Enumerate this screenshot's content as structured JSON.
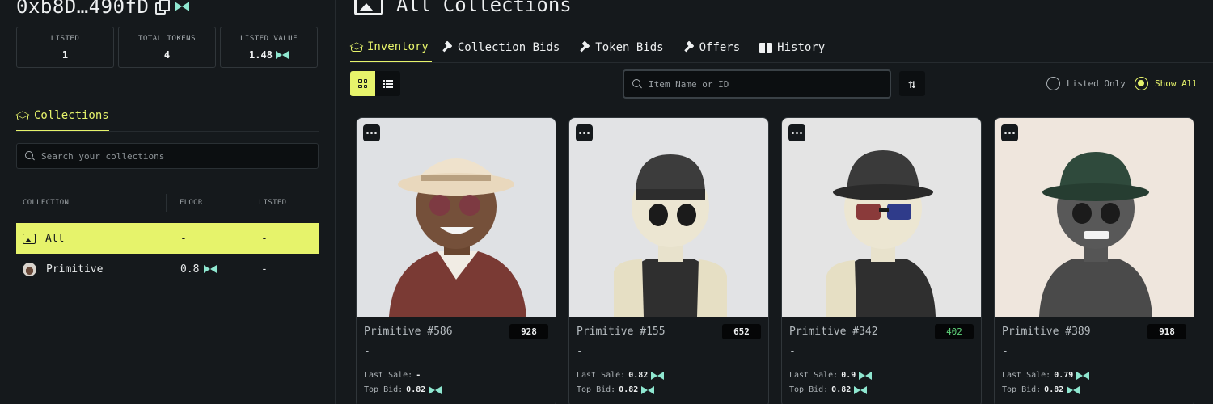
{
  "wallet": {
    "address": "0xb8D…490fD"
  },
  "stats": [
    {
      "label": "LISTED",
      "value": "1",
      "token": false
    },
    {
      "label": "TOTAL TOKENS",
      "value": "4",
      "token": false
    },
    {
      "label": "LISTED VALUE",
      "value": "1.48",
      "token": true
    }
  ],
  "collections_panel": {
    "tab_label": "Collections",
    "search_placeholder": "Search your collections",
    "headers": {
      "collection": "COLLECTION",
      "floor": "FLOOR",
      "listed": "LISTED"
    },
    "rows": [
      {
        "name": "All",
        "floor": "-",
        "listed": "-"
      },
      {
        "name": "Primitive",
        "floor": "0.8",
        "listed": "-"
      }
    ]
  },
  "main": {
    "title": "All Collections",
    "tabs": [
      "Inventory",
      "Collection Bids",
      "Token Bids",
      "Offers",
      "History"
    ],
    "search_placeholder": "Item Name or ID",
    "filters": {
      "listed_only": "Listed Only",
      "show_all": "Show All"
    }
  },
  "cards": [
    {
      "name": "Primitive #586",
      "rank": "928",
      "rank_color": "#eef0f1",
      "price": "-",
      "last_sale_label": "Last Sale:",
      "last_sale": "-",
      "last_sale_token": false,
      "top_bid_label": "Top Bid:",
      "top_bid": "0.82",
      "bg": "#dfe1e4"
    },
    {
      "name": "Primitive #155",
      "rank": "652",
      "rank_color": "#eef0f1",
      "price": "-",
      "last_sale_label": "Last Sale:",
      "last_sale": "0.82",
      "last_sale_token": true,
      "top_bid_label": "Top Bid:",
      "top_bid": "0.82",
      "bg": "#e2e3e5"
    },
    {
      "name": "Primitive #342",
      "rank": "402",
      "rank_color": "#5fd37a",
      "price": "-",
      "last_sale_label": "Last Sale:",
      "last_sale": "0.9",
      "last_sale_token": true,
      "top_bid_label": "Top Bid:",
      "top_bid": "0.82",
      "bg": "#e4e4e4"
    },
    {
      "name": "Primitive #389",
      "rank": "918",
      "rank_color": "#eef0f1",
      "price": "-",
      "last_sale_label": "Last Sale:",
      "last_sale": "0.79",
      "last_sale_token": true,
      "top_bid_label": "Top Bid:",
      "top_bid": "0.82",
      "bg": "#efe6dd"
    }
  ],
  "colors": {
    "accent": "#e6f36b",
    "token": "#8fe7d0",
    "bg": "#15191c"
  }
}
